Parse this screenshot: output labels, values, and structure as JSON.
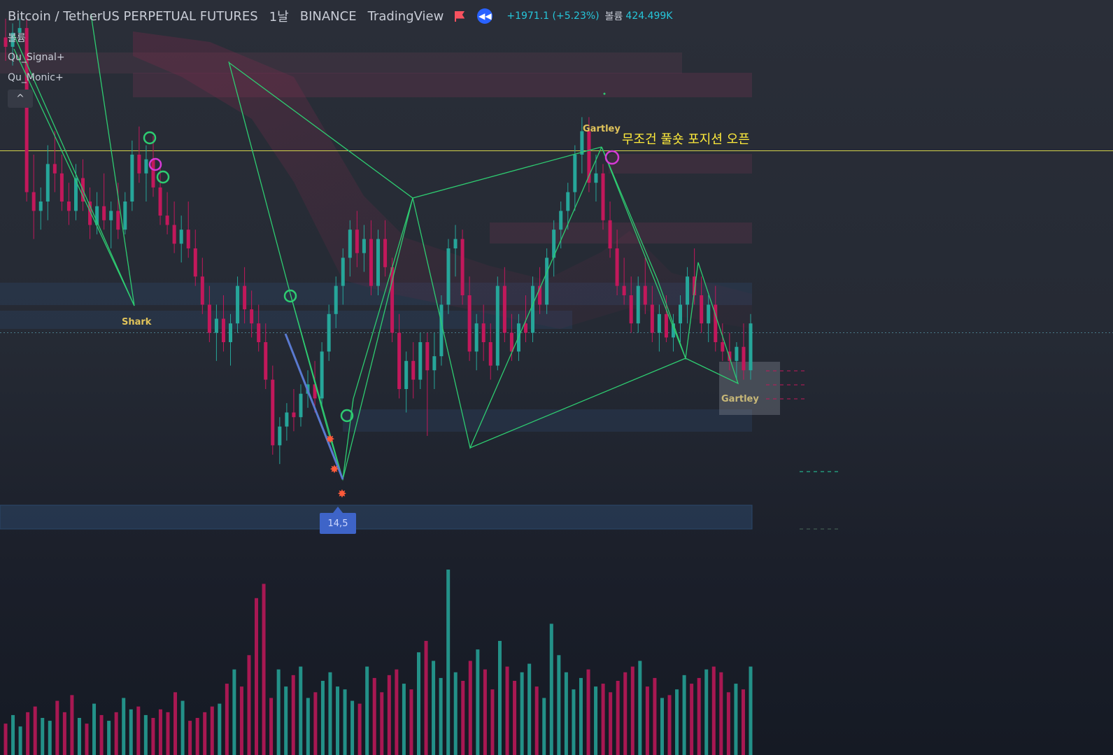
{
  "header": {
    "symbol": "Bitcoin / TetherUS PERPETUAL FUTURES",
    "interval": "1날",
    "exchange": "BINANCE",
    "source": "TradingView",
    "change": "+1971.1 (+5.23%)",
    "volume_label": "볼륨",
    "volume_value": "424.499K"
  },
  "indicators": [
    "볼륨",
    "Qu_Signal+",
    "Qu_Monic+"
  ],
  "collapse_label": "^",
  "annotation": "무조건 풀숏 포지션 오픈",
  "pattern_labels": {
    "shark": "Shark",
    "gartley_top": "Gartley",
    "gartley_right": "Gartley"
  },
  "signal_badge": "14,5",
  "colors": {
    "up": "#26a69a",
    "down": "#c2185b",
    "harmonic": "#2ecc71",
    "annotation": "#ffeb3b",
    "label": "#e0c35a",
    "magenta_circle": "#d63ad6",
    "green_circle": "#2ecc71"
  },
  "chart_data": {
    "type": "candlestick",
    "price_scale": {
      "min": 0,
      "max": 100,
      "note": "relative price units; price axis not visible"
    },
    "candles": [
      {
        "o": 95,
        "h": 99,
        "l": 90,
        "c": 93
      },
      {
        "o": 93,
        "h": 98,
        "l": 89,
        "c": 96
      },
      {
        "o": 96,
        "h": 99,
        "l": 94,
        "c": 97
      },
      {
        "o": 97,
        "h": 99,
        "l": 60,
        "c": 62
      },
      {
        "o": 62,
        "h": 70,
        "l": 52,
        "c": 58
      },
      {
        "o": 58,
        "h": 63,
        "l": 54,
        "c": 60
      },
      {
        "o": 60,
        "h": 72,
        "l": 56,
        "c": 68
      },
      {
        "o": 68,
        "h": 75,
        "l": 62,
        "c": 66
      },
      {
        "o": 66,
        "h": 70,
        "l": 58,
        "c": 60
      },
      {
        "o": 60,
        "h": 64,
        "l": 55,
        "c": 58
      },
      {
        "o": 58,
        "h": 68,
        "l": 56,
        "c": 65
      },
      {
        "o": 65,
        "h": 69,
        "l": 58,
        "c": 60
      },
      {
        "o": 60,
        "h": 63,
        "l": 52,
        "c": 55
      },
      {
        "o": 55,
        "h": 62,
        "l": 53,
        "c": 59
      },
      {
        "o": 59,
        "h": 66,
        "l": 54,
        "c": 56
      },
      {
        "o": 56,
        "h": 60,
        "l": 50,
        "c": 58
      },
      {
        "o": 58,
        "h": 64,
        "l": 52,
        "c": 54
      },
      {
        "o": 54,
        "h": 62,
        "l": 53,
        "c": 60
      },
      {
        "o": 60,
        "h": 73,
        "l": 58,
        "c": 70
      },
      {
        "o": 70,
        "h": 76,
        "l": 64,
        "c": 66
      },
      {
        "o": 66,
        "h": 72,
        "l": 60,
        "c": 69
      },
      {
        "o": 69,
        "h": 74,
        "l": 61,
        "c": 63
      },
      {
        "o": 63,
        "h": 68,
        "l": 55,
        "c": 57
      },
      {
        "o": 57,
        "h": 62,
        "l": 53,
        "c": 55
      },
      {
        "o": 55,
        "h": 60,
        "l": 49,
        "c": 51
      },
      {
        "o": 51,
        "h": 57,
        "l": 47,
        "c": 54
      },
      {
        "o": 54,
        "h": 60,
        "l": 48,
        "c": 50
      },
      {
        "o": 50,
        "h": 54,
        "l": 42,
        "c": 44
      },
      {
        "o": 44,
        "h": 48,
        "l": 36,
        "c": 38
      },
      {
        "o": 38,
        "h": 42,
        "l": 30,
        "c": 32
      },
      {
        "o": 32,
        "h": 38,
        "l": 26,
        "c": 35
      },
      {
        "o": 35,
        "h": 40,
        "l": 28,
        "c": 30
      },
      {
        "o": 30,
        "h": 36,
        "l": 25,
        "c": 34
      },
      {
        "o": 34,
        "h": 44,
        "l": 32,
        "c": 42
      },
      {
        "o": 42,
        "h": 46,
        "l": 34,
        "c": 37
      },
      {
        "o": 37,
        "h": 41,
        "l": 31,
        "c": 34
      },
      {
        "o": 34,
        "h": 38,
        "l": 28,
        "c": 30
      },
      {
        "o": 30,
        "h": 34,
        "l": 20,
        "c": 22
      },
      {
        "o": 22,
        "h": 25,
        "l": 6,
        "c": 8
      },
      {
        "o": 8,
        "h": 14,
        "l": 4,
        "c": 12
      },
      {
        "o": 12,
        "h": 17,
        "l": 9,
        "c": 15
      },
      {
        "o": 15,
        "h": 20,
        "l": 11,
        "c": 14
      },
      {
        "o": 14,
        "h": 21,
        "l": 12,
        "c": 19
      },
      {
        "o": 19,
        "h": 24,
        "l": 16,
        "c": 21
      },
      {
        "o": 21,
        "h": 26,
        "l": 15,
        "c": 18
      },
      {
        "o": 18,
        "h": 30,
        "l": 16,
        "c": 28
      },
      {
        "o": 28,
        "h": 38,
        "l": 26,
        "c": 36
      },
      {
        "o": 36,
        "h": 44,
        "l": 33,
        "c": 42
      },
      {
        "o": 42,
        "h": 50,
        "l": 38,
        "c": 48
      },
      {
        "o": 48,
        "h": 56,
        "l": 44,
        "c": 54
      },
      {
        "o": 54,
        "h": 58,
        "l": 46,
        "c": 49
      },
      {
        "o": 49,
        "h": 55,
        "l": 45,
        "c": 52
      },
      {
        "o": 52,
        "h": 56,
        "l": 40,
        "c": 42
      },
      {
        "o": 42,
        "h": 54,
        "l": 40,
        "c": 52
      },
      {
        "o": 52,
        "h": 56,
        "l": 44,
        "c": 46
      },
      {
        "o": 46,
        "h": 48,
        "l": 30,
        "c": 32
      },
      {
        "o": 32,
        "h": 36,
        "l": 18,
        "c": 20
      },
      {
        "o": 20,
        "h": 28,
        "l": 15,
        "c": 26
      },
      {
        "o": 26,
        "h": 30,
        "l": 18,
        "c": 22
      },
      {
        "o": 22,
        "h": 32,
        "l": 20,
        "c": 30
      },
      {
        "o": 30,
        "h": 32,
        "l": 10,
        "c": 24
      },
      {
        "o": 24,
        "h": 32,
        "l": 20,
        "c": 27
      },
      {
        "o": 27,
        "h": 40,
        "l": 25,
        "c": 38
      },
      {
        "o": 38,
        "h": 52,
        "l": 36,
        "c": 50
      },
      {
        "o": 50,
        "h": 55,
        "l": 44,
        "c": 52
      },
      {
        "o": 52,
        "h": 54,
        "l": 38,
        "c": 40
      },
      {
        "o": 40,
        "h": 44,
        "l": 26,
        "c": 28
      },
      {
        "o": 28,
        "h": 36,
        "l": 24,
        "c": 34
      },
      {
        "o": 34,
        "h": 38,
        "l": 26,
        "c": 30
      },
      {
        "o": 30,
        "h": 34,
        "l": 22,
        "c": 25
      },
      {
        "o": 25,
        "h": 44,
        "l": 24,
        "c": 42
      },
      {
        "o": 42,
        "h": 46,
        "l": 30,
        "c": 32
      },
      {
        "o": 32,
        "h": 36,
        "l": 26,
        "c": 28
      },
      {
        "o": 28,
        "h": 36,
        "l": 26,
        "c": 34
      },
      {
        "o": 34,
        "h": 40,
        "l": 30,
        "c": 32
      },
      {
        "o": 32,
        "h": 44,
        "l": 30,
        "c": 42
      },
      {
        "o": 42,
        "h": 46,
        "l": 36,
        "c": 38
      },
      {
        "o": 38,
        "h": 50,
        "l": 36,
        "c": 48
      },
      {
        "o": 48,
        "h": 56,
        "l": 44,
        "c": 54
      },
      {
        "o": 54,
        "h": 60,
        "l": 50,
        "c": 58
      },
      {
        "o": 58,
        "h": 64,
        "l": 54,
        "c": 62
      },
      {
        "o": 62,
        "h": 72,
        "l": 58,
        "c": 70
      },
      {
        "o": 70,
        "h": 78,
        "l": 66,
        "c": 75
      },
      {
        "o": 75,
        "h": 78,
        "l": 62,
        "c": 64
      },
      {
        "o": 64,
        "h": 70,
        "l": 60,
        "c": 66
      },
      {
        "o": 66,
        "h": 68,
        "l": 54,
        "c": 56
      },
      {
        "o": 56,
        "h": 60,
        "l": 48,
        "c": 50
      },
      {
        "o": 50,
        "h": 54,
        "l": 40,
        "c": 42
      },
      {
        "o": 42,
        "h": 48,
        "l": 38,
        "c": 40
      },
      {
        "o": 40,
        "h": 44,
        "l": 32,
        "c": 34
      },
      {
        "o": 34,
        "h": 44,
        "l": 32,
        "c": 42
      },
      {
        "o": 42,
        "h": 48,
        "l": 36,
        "c": 38
      },
      {
        "o": 38,
        "h": 42,
        "l": 30,
        "c": 32
      },
      {
        "o": 32,
        "h": 38,
        "l": 28,
        "c": 36
      },
      {
        "o": 36,
        "h": 40,
        "l": 30,
        "c": 31
      },
      {
        "o": 31,
        "h": 36,
        "l": 28,
        "c": 34
      },
      {
        "o": 34,
        "h": 40,
        "l": 30,
        "c": 38
      },
      {
        "o": 38,
        "h": 46,
        "l": 34,
        "c": 44
      },
      {
        "o": 44,
        "h": 50,
        "l": 38,
        "c": 40
      },
      {
        "o": 40,
        "h": 44,
        "l": 32,
        "c": 34
      },
      {
        "o": 34,
        "h": 40,
        "l": 30,
        "c": 38
      },
      {
        "o": 38,
        "h": 42,
        "l": 28,
        "c": 30
      },
      {
        "o": 30,
        "h": 34,
        "l": 26,
        "c": 28
      },
      {
        "o": 28,
        "h": 32,
        "l": 24,
        "c": 26
      },
      {
        "o": 26,
        "h": 30,
        "l": 22,
        "c": 29
      },
      {
        "o": 29,
        "h": 34,
        "l": 22,
        "c": 24
      },
      {
        "o": 24,
        "h": 36,
        "l": 22,
        "c": 34
      }
    ],
    "volume": [
      22,
      28,
      20,
      30,
      34,
      26,
      24,
      38,
      30,
      42,
      26,
      22,
      36,
      28,
      24,
      30,
      40,
      32,
      34,
      28,
      26,
      32,
      30,
      44,
      38,
      24,
      26,
      30,
      34,
      36,
      50,
      60,
      48,
      70,
      110,
      120,
      40,
      60,
      48,
      56,
      62,
      40,
      44,
      52,
      58,
      48,
      46,
      38,
      36,
      62,
      54,
      44,
      56,
      60,
      50,
      46,
      72,
      80,
      66,
      54,
      130,
      58,
      52,
      66,
      74,
      60,
      46,
      80,
      62,
      52,
      58,
      64,
      48,
      40,
      92,
      70,
      58,
      46,
      54,
      60,
      48,
      50,
      44,
      52,
      58,
      62,
      66,
      48,
      54,
      40,
      42,
      46,
      56,
      50,
      54,
      60,
      62,
      58,
      44,
      50,
      46,
      62
    ],
    "overlays": {
      "horizontal_line": 67,
      "dotted_line": 24.5
    }
  }
}
